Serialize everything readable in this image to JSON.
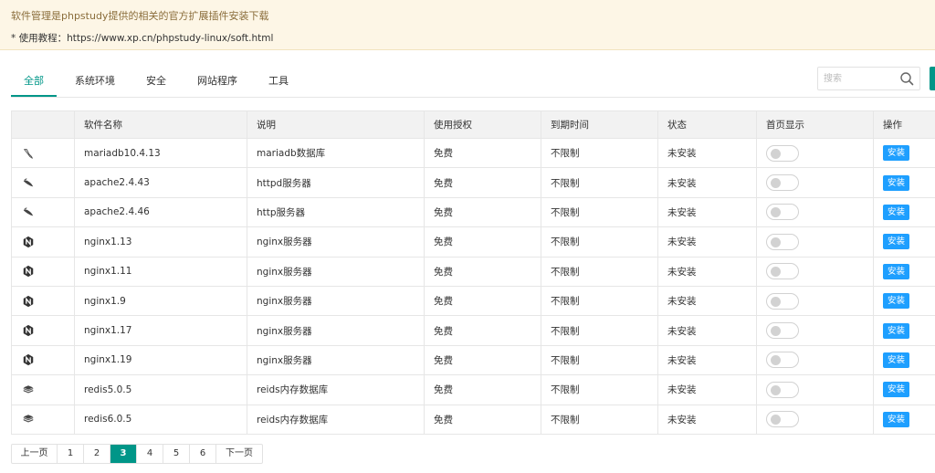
{
  "notice": {
    "line1": "软件管理是phpstudy提供的相关的官方扩展插件安装下载",
    "line2": "* 使用教程：https://www.xp.cn/phpstudy-linux/soft.html"
  },
  "tabs": [
    {
      "label": "全部",
      "active": true
    },
    {
      "label": "系统环境",
      "active": false
    },
    {
      "label": "安全",
      "active": false
    },
    {
      "label": "网站程序",
      "active": false
    },
    {
      "label": "工具",
      "active": false
    }
  ],
  "search": {
    "placeholder": "搜索"
  },
  "table": {
    "columns": [
      "",
      "软件名称",
      "说明",
      "使用授权",
      "到期时间",
      "状态",
      "首页显示",
      "操作"
    ],
    "rows": [
      {
        "icon": "mariadb-icon",
        "name": "mariadb10.4.13",
        "desc": "mariadb数据库",
        "license": "免费",
        "expire": "不限制",
        "status": "未安装",
        "home_display": false,
        "action": "安装"
      },
      {
        "icon": "apache-icon",
        "name": "apache2.4.43",
        "desc": "httpd服务器",
        "license": "免费",
        "expire": "不限制",
        "status": "未安装",
        "home_display": false,
        "action": "安装"
      },
      {
        "icon": "apache-icon",
        "name": "apache2.4.46",
        "desc": "http服务器",
        "license": "免费",
        "expire": "不限制",
        "status": "未安装",
        "home_display": false,
        "action": "安装"
      },
      {
        "icon": "nginx-icon",
        "name": "nginx1.13",
        "desc": "nginx服务器",
        "license": "免费",
        "expire": "不限制",
        "status": "未安装",
        "home_display": false,
        "action": "安装"
      },
      {
        "icon": "nginx-icon",
        "name": "nginx1.11",
        "desc": "nginx服务器",
        "license": "免费",
        "expire": "不限制",
        "status": "未安装",
        "home_display": false,
        "action": "安装"
      },
      {
        "icon": "nginx-icon",
        "name": "nginx1.9",
        "desc": "nginx服务器",
        "license": "免费",
        "expire": "不限制",
        "status": "未安装",
        "home_display": false,
        "action": "安装"
      },
      {
        "icon": "nginx-icon",
        "name": "nginx1.17",
        "desc": "nginx服务器",
        "license": "免费",
        "expire": "不限制",
        "status": "未安装",
        "home_display": false,
        "action": "安装"
      },
      {
        "icon": "nginx-icon",
        "name": "nginx1.19",
        "desc": "nginx服务器",
        "license": "免费",
        "expire": "不限制",
        "status": "未安装",
        "home_display": false,
        "action": "安装"
      },
      {
        "icon": "redis-icon",
        "name": "redis5.0.5",
        "desc": "reids内存数据库",
        "license": "免费",
        "expire": "不限制",
        "status": "未安装",
        "home_display": false,
        "action": "安装"
      },
      {
        "icon": "redis-icon",
        "name": "redis6.0.5",
        "desc": "reids内存数据库",
        "license": "免费",
        "expire": "不限制",
        "status": "未安装",
        "home_display": false,
        "action": "安装"
      }
    ]
  },
  "pagination": {
    "prev": "上一页",
    "next": "下一页",
    "pages": [
      "1",
      "2",
      "3",
      "4",
      "5",
      "6"
    ],
    "current": "3"
  },
  "colors": {
    "accent": "#009688",
    "button": "#1e9fff",
    "notice_bg": "#fdf6e6"
  }
}
